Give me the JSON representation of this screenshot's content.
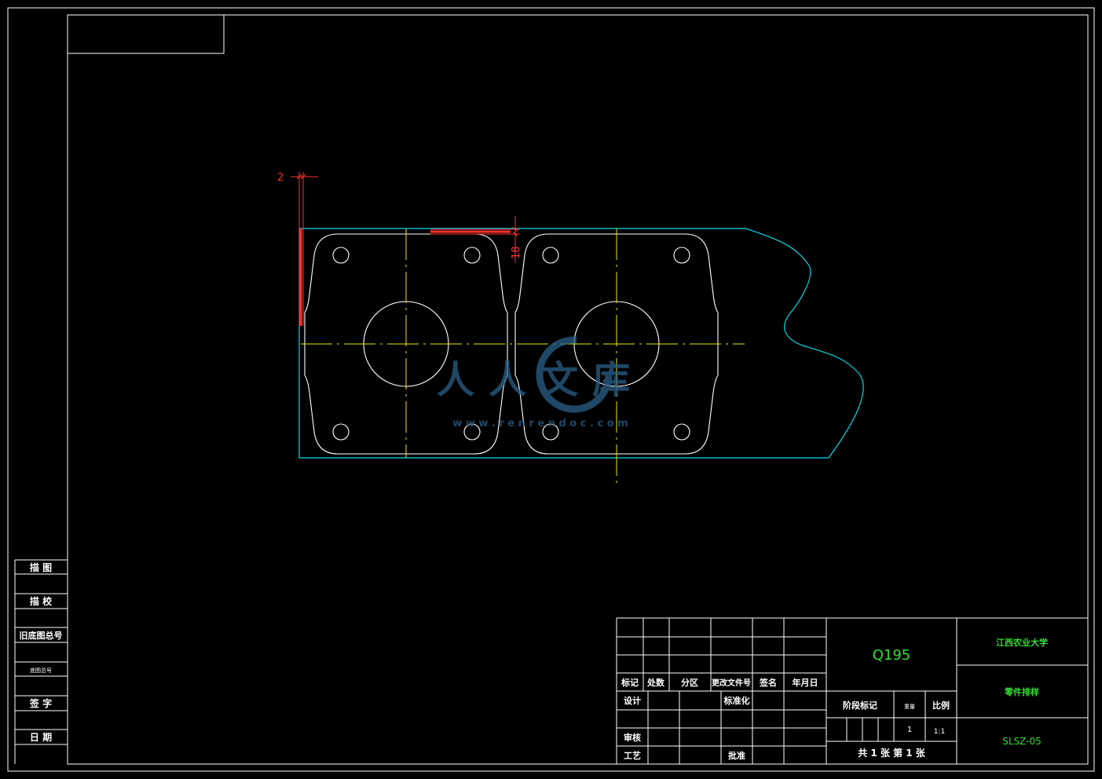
{
  "left_strip": {
    "cells": [
      "描  图",
      "描  校",
      "旧底图总号",
      "底图总号",
      "签  字",
      "日  期"
    ]
  },
  "dimensions": {
    "thickness": "2",
    "edge": "18"
  },
  "watermark": {
    "brand": "人人文库",
    "url": "w w w . r e n r e n d o c . c o m"
  },
  "title_block": {
    "header_labels": [
      "标记",
      "处数",
      "分区",
      "更改文件号",
      "签名",
      "年月日"
    ],
    "design": "设计",
    "standardize": "标准化",
    "review": "审核",
    "process": "工艺",
    "approve": "批准",
    "material": "Q195",
    "stage_mark": "阶段标记",
    "weight": "重量",
    "scale_label": "比例",
    "quantity": "1",
    "scale_value": "1:1",
    "sheets": "共 1 张   第 1 张",
    "school": "江西农业大学",
    "part_name": "零件排样",
    "drawing_no": "SLSZ-05"
  },
  "colors": {
    "border": "#ffffff",
    "strip": "#00d8e8",
    "center_line": "#e8e800",
    "dimension": "#ff3030",
    "label_green": "#33dd33",
    "watermark": "#2a5f88"
  }
}
